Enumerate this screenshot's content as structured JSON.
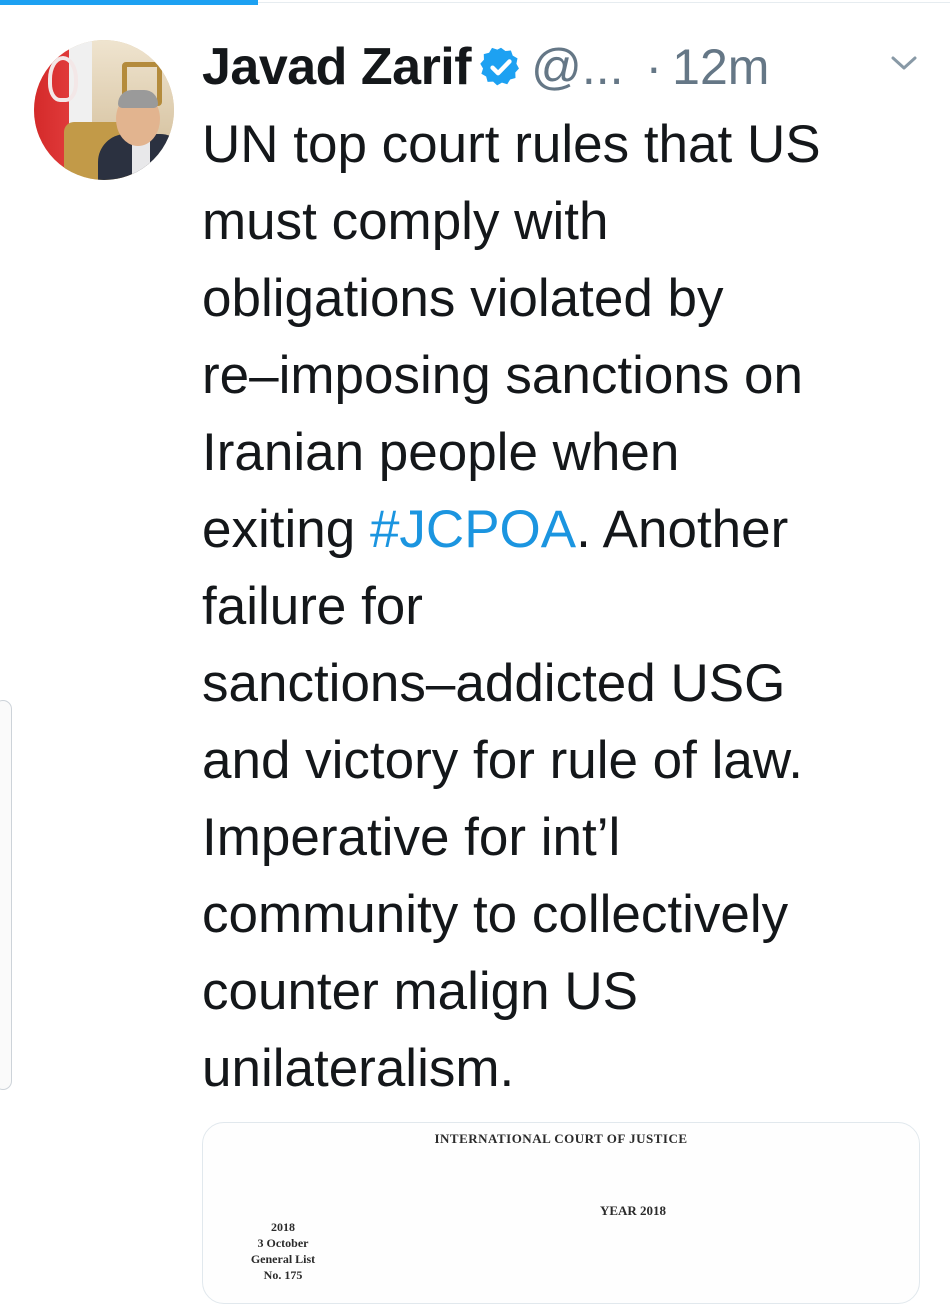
{
  "tweet": {
    "author_name": "Javad Zarif",
    "handle": "@...",
    "separator": "·",
    "timestamp": "12m",
    "text_lines": [
      "UN top court rules that US",
      "must comply with",
      "obligations violated by",
      "re–imposing sanctions on",
      "Iranian people when",
      "exiting ",
      "failure for",
      "sanctions–addicted USG",
      "and victory for rule of law.",
      "Imperative for int’l",
      "community to collectively",
      "counter malign US",
      "unilateralism."
    ],
    "hashtag": "#JCPOA",
    "after_hashtag": ". Another"
  },
  "media": {
    "doc_title": "INTERNATIONAL COURT OF JUSTICE",
    "doc_year": "YEAR 2018",
    "doc_meta": [
      "2018",
      "3 October",
      "General List",
      "No. 175"
    ]
  },
  "colors": {
    "link": "#1b95e0",
    "verified": "#1da1f2",
    "secondary_text": "#657786",
    "primary_text": "#14171a"
  },
  "icons": {
    "verified": "verified-badge-icon",
    "menu": "chevron-down-icon"
  }
}
